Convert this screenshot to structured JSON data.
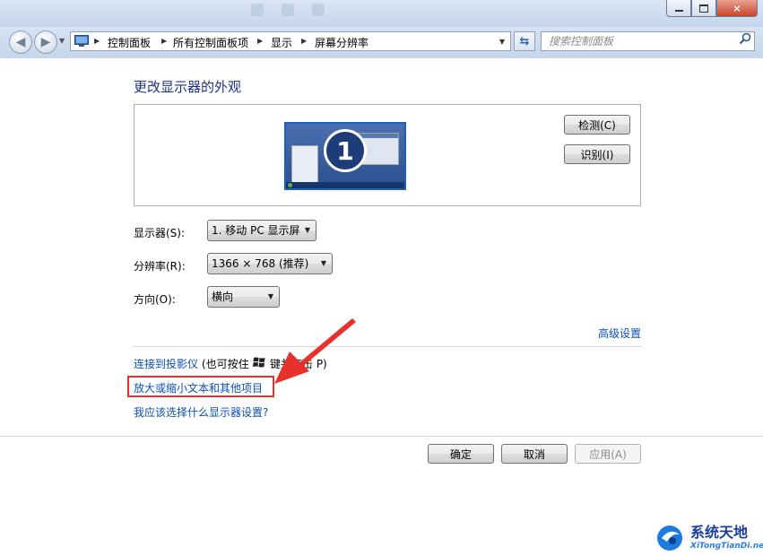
{
  "window": {
    "minimize_glyph": "",
    "maximize_glyph": "",
    "close_glyph": "×"
  },
  "navbar": {
    "back_icon": "back-arrow-icon",
    "forward_icon": "forward-arrow-icon",
    "breadcrumbs": [
      "控制面板",
      "所有控制面板项",
      "显示",
      "屏幕分辨率"
    ],
    "search_placeholder": "搜索控制面板",
    "refresh_glyph": "⇆"
  },
  "page": {
    "title": "更改显示器的外观",
    "monitor_number": "1",
    "detect_button": "检测(C)",
    "identify_button": "识别(I)"
  },
  "form": {
    "display_label": "显示器(S):",
    "display_value": "1. 移动 PC 显示屏",
    "resolution_label": "分辨率(R):",
    "resolution_value": "1366 × 768 (推荐)",
    "orientation_label": "方向(O):",
    "orientation_value": "横向",
    "advanced_link": "高级设置"
  },
  "links": {
    "projector_link": "连接到投影仪",
    "projector_hint_pre": "(也可按住",
    "projector_hint_post": "键并点击 P)",
    "text_size_link": "放大或缩小文本和其他项目",
    "help_link": "我应该选择什么显示器设置?"
  },
  "footer": {
    "ok": "确定",
    "cancel": "取消",
    "apply": "应用(A)"
  },
  "watermark": {
    "name": "系统天地",
    "url": "XiTongTianDi.net"
  },
  "colors": {
    "link": "#0a4fb5",
    "title": "#1e3287",
    "highlight": "#e8312c"
  }
}
